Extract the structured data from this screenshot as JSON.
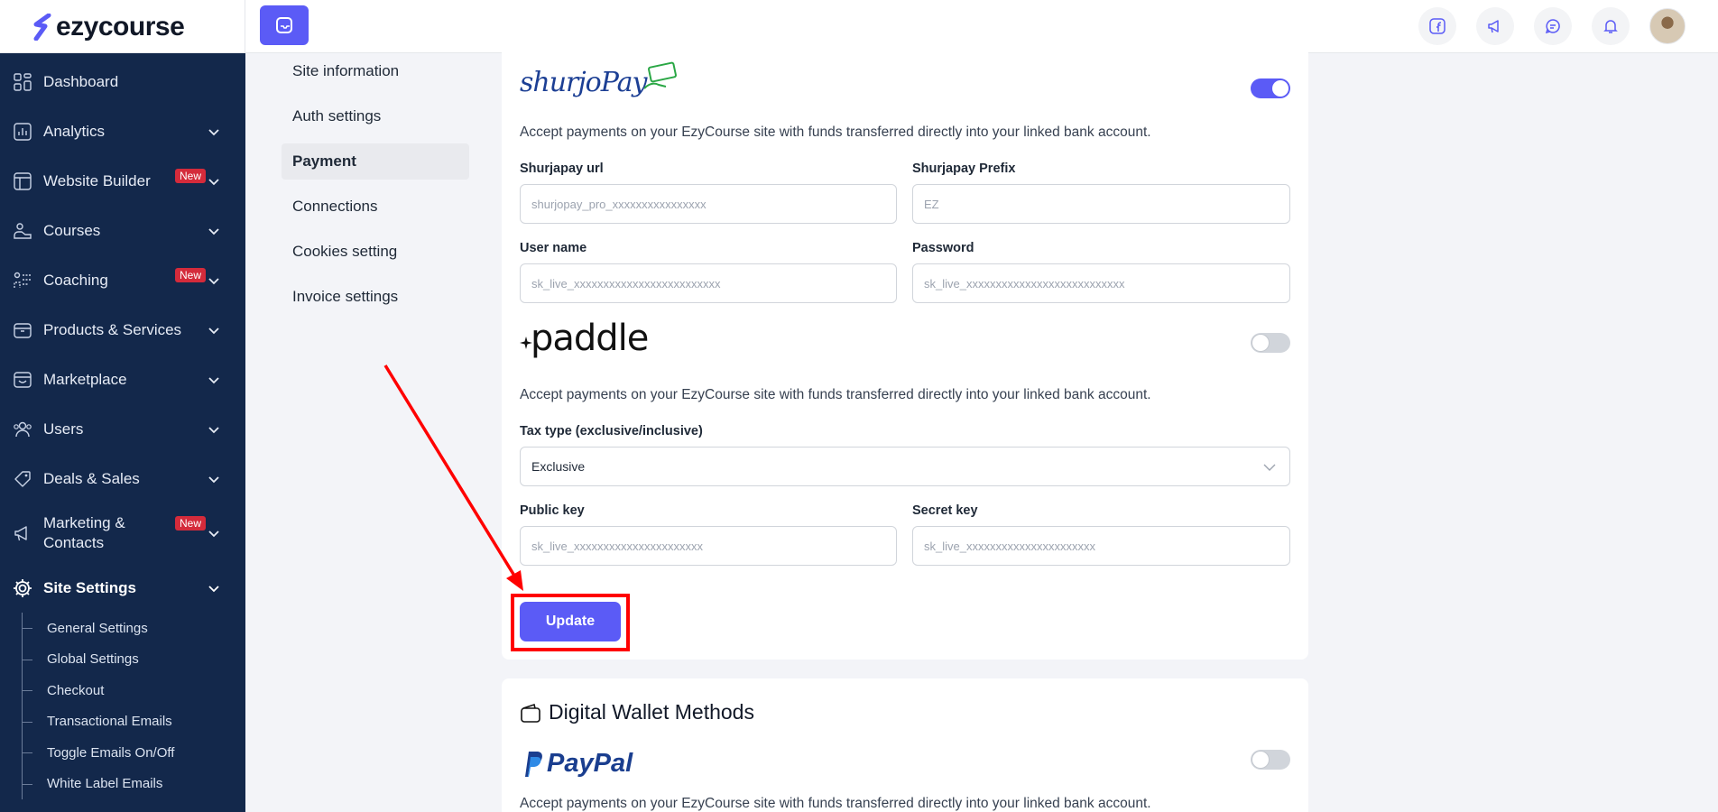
{
  "brand": {
    "name": "ezycourse"
  },
  "sidebar": {
    "items": [
      {
        "label": "Dashboard",
        "icon": "grid-icon"
      },
      {
        "label": "Analytics",
        "icon": "chart-icon"
      },
      {
        "label": "Website Builder",
        "icon": "layout-icon",
        "badge": "New"
      },
      {
        "label": "Courses",
        "icon": "courses-icon"
      },
      {
        "label": "Coaching",
        "icon": "coaching-icon",
        "badge": "New"
      },
      {
        "label": "Products & Services",
        "icon": "box-icon"
      },
      {
        "label": "Marketplace",
        "icon": "store-icon"
      },
      {
        "label": "Users",
        "icon": "users-icon"
      },
      {
        "label": "Deals & Sales",
        "icon": "tag-icon"
      },
      {
        "label": "Marketing &",
        "label2": "Contacts",
        "icon": "megaphone-icon",
        "badge": "New"
      },
      {
        "label": "Site Settings",
        "icon": "gear-icon"
      }
    ],
    "subitems": [
      "General Settings",
      "Global Settings",
      "Checkout",
      "Transactional Emails",
      "Toggle Emails On/Off",
      "White Label Emails"
    ]
  },
  "settings_menu": [
    "Site information",
    "Auth settings",
    "Payment",
    "Connections",
    "Cookies setting",
    "Invoice settings"
  ],
  "shurjopay": {
    "logo": "shurjoPay",
    "description": "Accept payments on your EzyCourse site with funds transferred directly into your linked bank account.",
    "url_label": "Shurjapay url",
    "url_placeholder": "shurjopay_pro_xxxxxxxxxxxxxxxx",
    "prefix_label": "Shurjapay Prefix",
    "prefix_placeholder": "EZ",
    "username_label": "User name",
    "username_placeholder": "sk_live_xxxxxxxxxxxxxxxxxxxxxxxxx",
    "password_label": "Password",
    "password_placeholder": "sk_live_xxxxxxxxxxxxxxxxxxxxxxxxxxx",
    "enabled": true
  },
  "paddle": {
    "logo": "paddle",
    "description": "Accept payments on your EzyCourse site with funds transferred directly into your linked bank account.",
    "tax_label": "Tax type (exclusive/inclusive)",
    "tax_value": "Exclusive",
    "public_label": "Public key",
    "public_placeholder": "sk_live_xxxxxxxxxxxxxxxxxxxxxx",
    "secret_label": "Secret key",
    "secret_placeholder": "sk_live_xxxxxxxxxxxxxxxxxxxxxx",
    "enabled": false
  },
  "update_label": "Update",
  "wallet": {
    "title": "Digital Wallet Methods",
    "paypal_logo": "PayPal",
    "description": "Accept payments on your EzyCourse site with funds transferred directly into your linked bank account.",
    "enabled": false
  },
  "colors": {
    "accent": "#5b5bf6",
    "sidebar": "#13284b",
    "highlight": "#ff0000",
    "badge": "#d42b3b"
  }
}
